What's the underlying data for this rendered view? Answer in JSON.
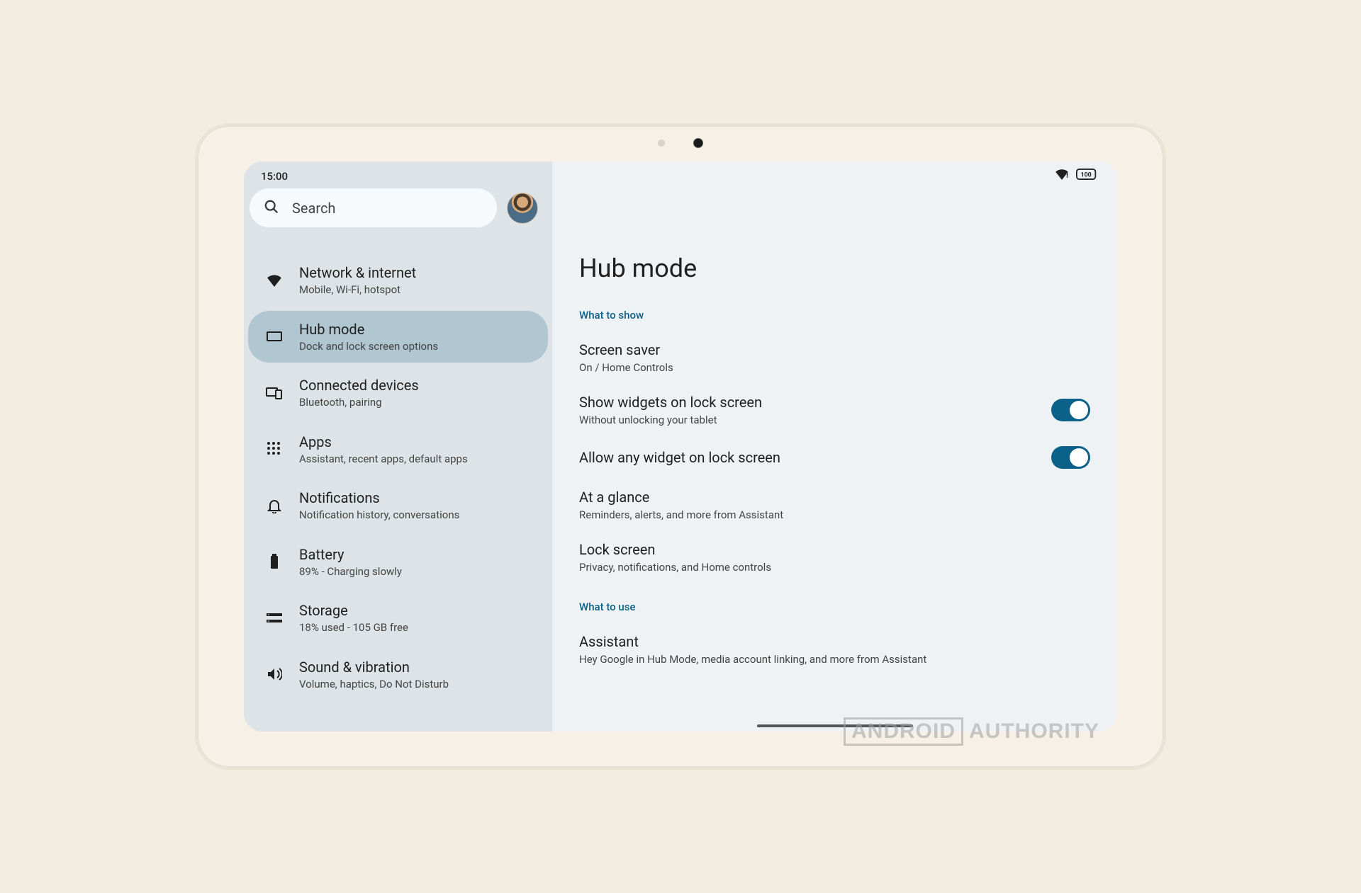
{
  "status": {
    "time": "15:00",
    "battery_text": "100"
  },
  "search": {
    "placeholder": "Search"
  },
  "sidebar": {
    "items": [
      {
        "icon": "wifi",
        "title": "Network & internet",
        "sub": "Mobile, Wi-Fi, hotspot",
        "selected": false
      },
      {
        "icon": "hub",
        "title": "Hub mode",
        "sub": "Dock and lock screen options",
        "selected": true
      },
      {
        "icon": "devices",
        "title": "Connected devices",
        "sub": "Bluetooth, pairing",
        "selected": false
      },
      {
        "icon": "apps",
        "title": "Apps",
        "sub": "Assistant, recent apps, default apps",
        "selected": false
      },
      {
        "icon": "bell",
        "title": "Notifications",
        "sub": "Notification history, conversations",
        "selected": false
      },
      {
        "icon": "battery",
        "title": "Battery",
        "sub": "89% - Charging slowly",
        "selected": false
      },
      {
        "icon": "storage",
        "title": "Storage",
        "sub": "18% used - 105 GB free",
        "selected": false
      },
      {
        "icon": "sound",
        "title": "Sound & vibration",
        "sub": "Volume, haptics, Do Not Disturb",
        "selected": false
      }
    ]
  },
  "detail": {
    "title": "Hub mode",
    "sections": [
      {
        "header": "What to show",
        "rows": [
          {
            "title": "Screen saver",
            "sub": "On / Home Controls",
            "toggle": null
          },
          {
            "title": "Show widgets on lock screen",
            "sub": "Without unlocking your tablet",
            "toggle": true
          },
          {
            "title": "Allow any widget on lock screen",
            "sub": null,
            "toggle": true
          },
          {
            "title": "At a glance",
            "sub": "Reminders, alerts, and more from Assistant",
            "toggle": null
          },
          {
            "title": "Lock screen",
            "sub": "Privacy, notifications, and Home controls",
            "toggle": null
          }
        ]
      },
      {
        "header": "What to use",
        "rows": [
          {
            "title": "Assistant",
            "sub": "Hey Google in Hub Mode, media account linking, and more from Assistant",
            "toggle": null
          }
        ]
      }
    ]
  },
  "watermark": {
    "left": "ANDROID",
    "right": "AUTHORITY"
  }
}
